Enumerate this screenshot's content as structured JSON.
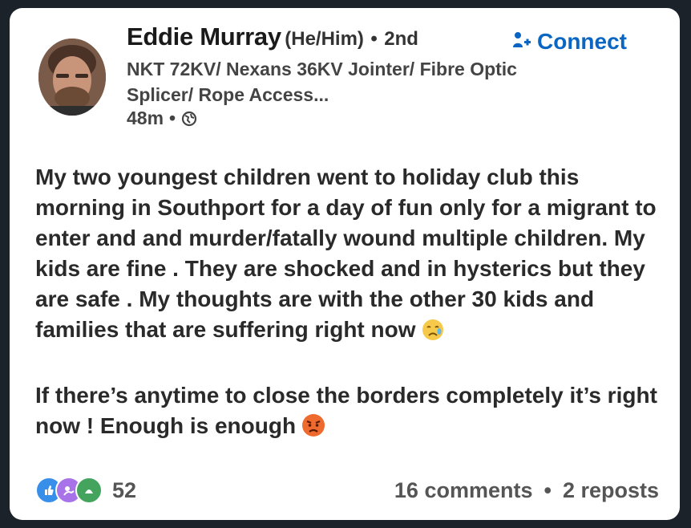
{
  "post": {
    "author": {
      "name": "Eddie Murray",
      "pronouns": "(He/Him)",
      "separator": "•",
      "degree": "2nd",
      "headline": "NKT 72KV/ Nexans 36KV Jointer/ Fibre Optic Splicer/ Rope Access...",
      "timestamp": "48m",
      "meta_separator": "•",
      "visibility_icon": "globe-icon"
    },
    "connect_label": "Connect",
    "connect_icon": "add-person-icon",
    "body": {
      "paragraph_1": "My two youngest children went to holiday club this morning in Southport  for a day of fun only for a migrant to enter and and murder/fatally wound multiple children. My kids are fine . They are shocked and in hysterics but they are safe . My thoughts are with the other 30 kids and families that are suffering right now",
      "paragraph_1_emoji": "crying-face-emoji",
      "paragraph_2": "If there’s anytime to close the borders completely it’s right now !  Enough is enough",
      "paragraph_2_emoji": "angry-face-emoji"
    },
    "footer": {
      "reaction_icons": [
        "like-icon",
        "support-icon",
        "insightful-icon"
      ],
      "reaction_count": "52",
      "comments": "16 comments",
      "separator": "•",
      "reposts": "2 reposts"
    }
  },
  "colors": {
    "background": "#1c2229",
    "card": "#ffffff",
    "accent": "#0a66c2",
    "text": "#2a2a2a"
  }
}
